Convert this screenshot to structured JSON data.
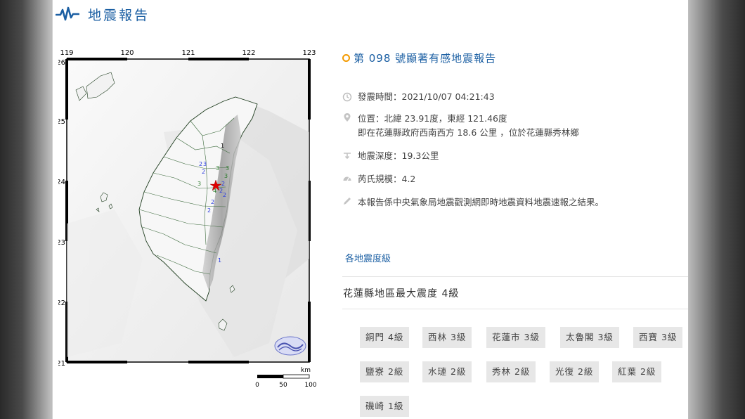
{
  "header": {
    "title": "地震報告"
  },
  "map": {
    "lon_ticks": [
      "119",
      "120",
      "121",
      "122",
      "123"
    ],
    "lat_ticks": [
      "26",
      "25",
      "24",
      "23",
      "22",
      "21"
    ],
    "scale": {
      "unit": "km",
      "labels": [
        "0",
        "50",
        "100"
      ]
    },
    "intensity_markers": [
      "1",
      "2",
      "3",
      "3",
      "3",
      "2",
      "3",
      "2",
      "2",
      "3",
      "2",
      "2",
      "2",
      "1",
      "4"
    ]
  },
  "report": {
    "title": "第 098 號顯著有感地震報告",
    "time": "發震時間：2021/10/07 04:21:43",
    "location_line1": "位置：北緯 23.91度，東經 121.46度",
    "location_line2": "即在花蓮縣政府西南西方 18.6 公里 ，位於花蓮縣秀林鄉",
    "depth": "地震深度：19.3公里",
    "magnitude": "芮氏規模：4.2",
    "note": "本報告係中央氣象局地震觀測網即時地震資料地震速報之結果。",
    "levels_link": "各地震度級",
    "max_level": "花蓮縣地區最大震度 4級",
    "stations": [
      "銅門 4級",
      "西林 3級",
      "花蓮市 3級",
      "太魯閣 3級",
      "西寶 3級",
      "鹽寮 2級",
      "水璉 2級",
      "秀林 2級",
      "光復 2級",
      "紅葉 2級",
      "磯崎 1級"
    ]
  },
  "colors": {
    "accent": "#1b5fa3",
    "orange": "#f39a00",
    "tag_bg": "#e7e7e7"
  },
  "icons": {
    "header": "seismograph-icon",
    "title": "ring-icon",
    "time": "clock-icon",
    "location": "pin-icon",
    "depth": "depth-icon",
    "magnitude": "scale-icon",
    "note": "pen-icon"
  }
}
